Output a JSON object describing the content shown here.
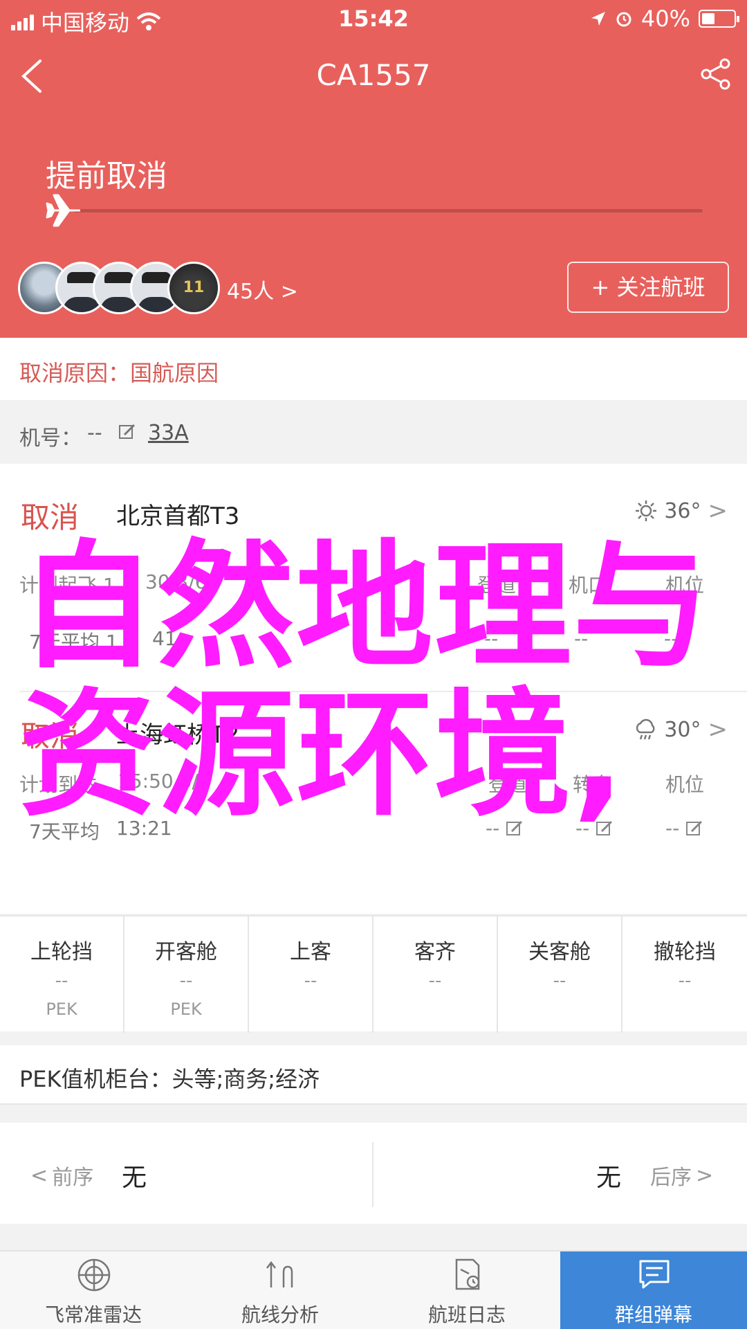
{
  "status_bar": {
    "carrier": "中国移动",
    "time": "15:42",
    "battery": "40%",
    "battery_level": 0.4
  },
  "header": {
    "title": "CA1557",
    "flight_status": "提前取消",
    "progress": 0,
    "follower_count": "45人",
    "follow_button": "+ 关注航班",
    "avatar_jersey_number": "11"
  },
  "cancel_reason": "取消原因：国航原因",
  "aircraft": {
    "label": "机号：",
    "value": "--",
    "registration": "33A"
  },
  "segments": [
    {
      "status": "取消",
      "airport": "北京首都T3",
      "weather": "36°",
      "schedule_label": "计划起飞 1",
      "schedule_time": "30 3/6",
      "col1": "登道",
      "col2": "机口",
      "col3": "机位",
      "avg_label": "7天平均 1",
      "avg_time": "41",
      "dash1": "--",
      "dash2": "--",
      "dash3": "--"
    },
    {
      "status": "取消",
      "airport": "上海虹桥T2",
      "weather": "30°",
      "schedule_label": "计划到达",
      "schedule_time": "15:50 3/6",
      "col1": "登道",
      "col2": "转盘",
      "col3": "机位",
      "avg_label": "7天平均",
      "avg_time": "13:21",
      "dash1": "--",
      "dash2": "--",
      "dash3": "--"
    }
  ],
  "events": [
    {
      "name": "上轮挡",
      "time": "--",
      "loc": "PEK"
    },
    {
      "name": "开客舱",
      "time": "--",
      "loc": "PEK"
    },
    {
      "name": "上客",
      "time": "--",
      "loc": ""
    },
    {
      "name": "客齐",
      "time": "--",
      "loc": ""
    },
    {
      "name": "关客舱",
      "time": "--",
      "loc": ""
    },
    {
      "name": "撤轮挡",
      "time": "--",
      "loc": ""
    }
  ],
  "checkin_counter": "PEK值机柜台：头等;商务;经济",
  "prev_next": {
    "prev_label": "前序",
    "prev_value": "无",
    "next_value": "无",
    "next_label": "后序"
  },
  "tabs": [
    {
      "label": "飞常准雷达",
      "icon": "radar-icon",
      "active": false
    },
    {
      "label": "航线分析",
      "icon": "route-analysis-icon",
      "active": false
    },
    {
      "label": "航班日志",
      "icon": "flight-log-icon",
      "active": false
    },
    {
      "label": "群组弹幕",
      "icon": "group-chat-icon",
      "active": true
    }
  ],
  "watermark": {
    "line1": "自然地理与",
    "line2": "资源环境,",
    "color": "#ff1cff"
  },
  "colors": {
    "header_bg": "#e8605c",
    "cancel_red": "#d9534f",
    "tab_active": "#3d86d8"
  }
}
